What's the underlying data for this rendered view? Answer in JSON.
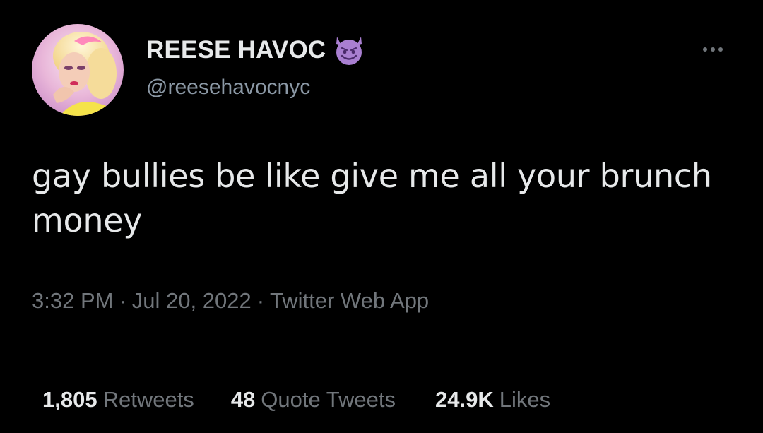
{
  "user": {
    "display_name": "REESE HAVOC",
    "handle": "@reesehavocnyc",
    "name_emoji": "smiling-face-with-horns-icon"
  },
  "tweet": {
    "text": "gay bullies be like give me all your brunch money"
  },
  "meta": {
    "time": "3:32 PM",
    "separator": "·",
    "date": "Jul 20, 2022",
    "source": "Twitter Web App"
  },
  "stats": {
    "retweets_count": "1,805",
    "retweets_label": "Retweets",
    "quotes_count": "48",
    "quotes_label": "Quote Tweets",
    "likes_count": "24.9K",
    "likes_label": "Likes"
  },
  "colors": {
    "background": "#000000",
    "primary_text": "#e7e9ea",
    "secondary_text": "#71767b",
    "emoji_purple": "#a97fd1",
    "divider": "#2f3336"
  }
}
